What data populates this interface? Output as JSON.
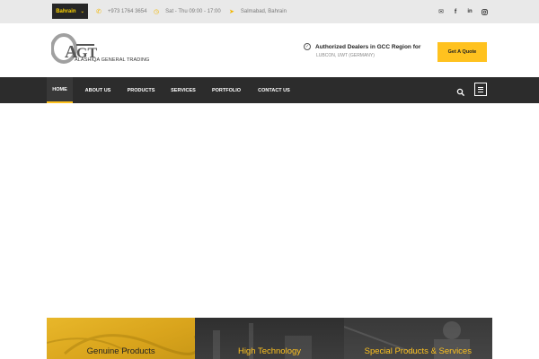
{
  "topbar": {
    "country": "Bahrain",
    "phone": "+973 1764 3654",
    "hours": "Sat - Thu 09:00 - 17:00",
    "location": "Salmabad, Bahrain",
    "social": [
      "envelope-icon",
      "facebook-icon",
      "linkedin-icon",
      "instagram-icon"
    ]
  },
  "header": {
    "logo_text": "ALASHIQA GENERAL TRADING",
    "authorized_title": "Authorized Dealers in GCC Region for",
    "authorized_sub": "LUBCON, UWT (GERMANY)",
    "quote_button": "Get A Quote"
  },
  "nav": {
    "items": [
      "HOME",
      "ABOUT US",
      "PRODUCTS",
      "SERVICES",
      "PORTFOLIO",
      "CONTACT US"
    ],
    "active": "HOME"
  },
  "features": [
    {
      "label": "Genuine Products"
    },
    {
      "label": "High Technology"
    },
    {
      "label": "Special Products & Services"
    }
  ],
  "colors": {
    "accent": "#ffc21f",
    "dark": "#2c2c2c",
    "topbar": "#e9e9e9"
  }
}
